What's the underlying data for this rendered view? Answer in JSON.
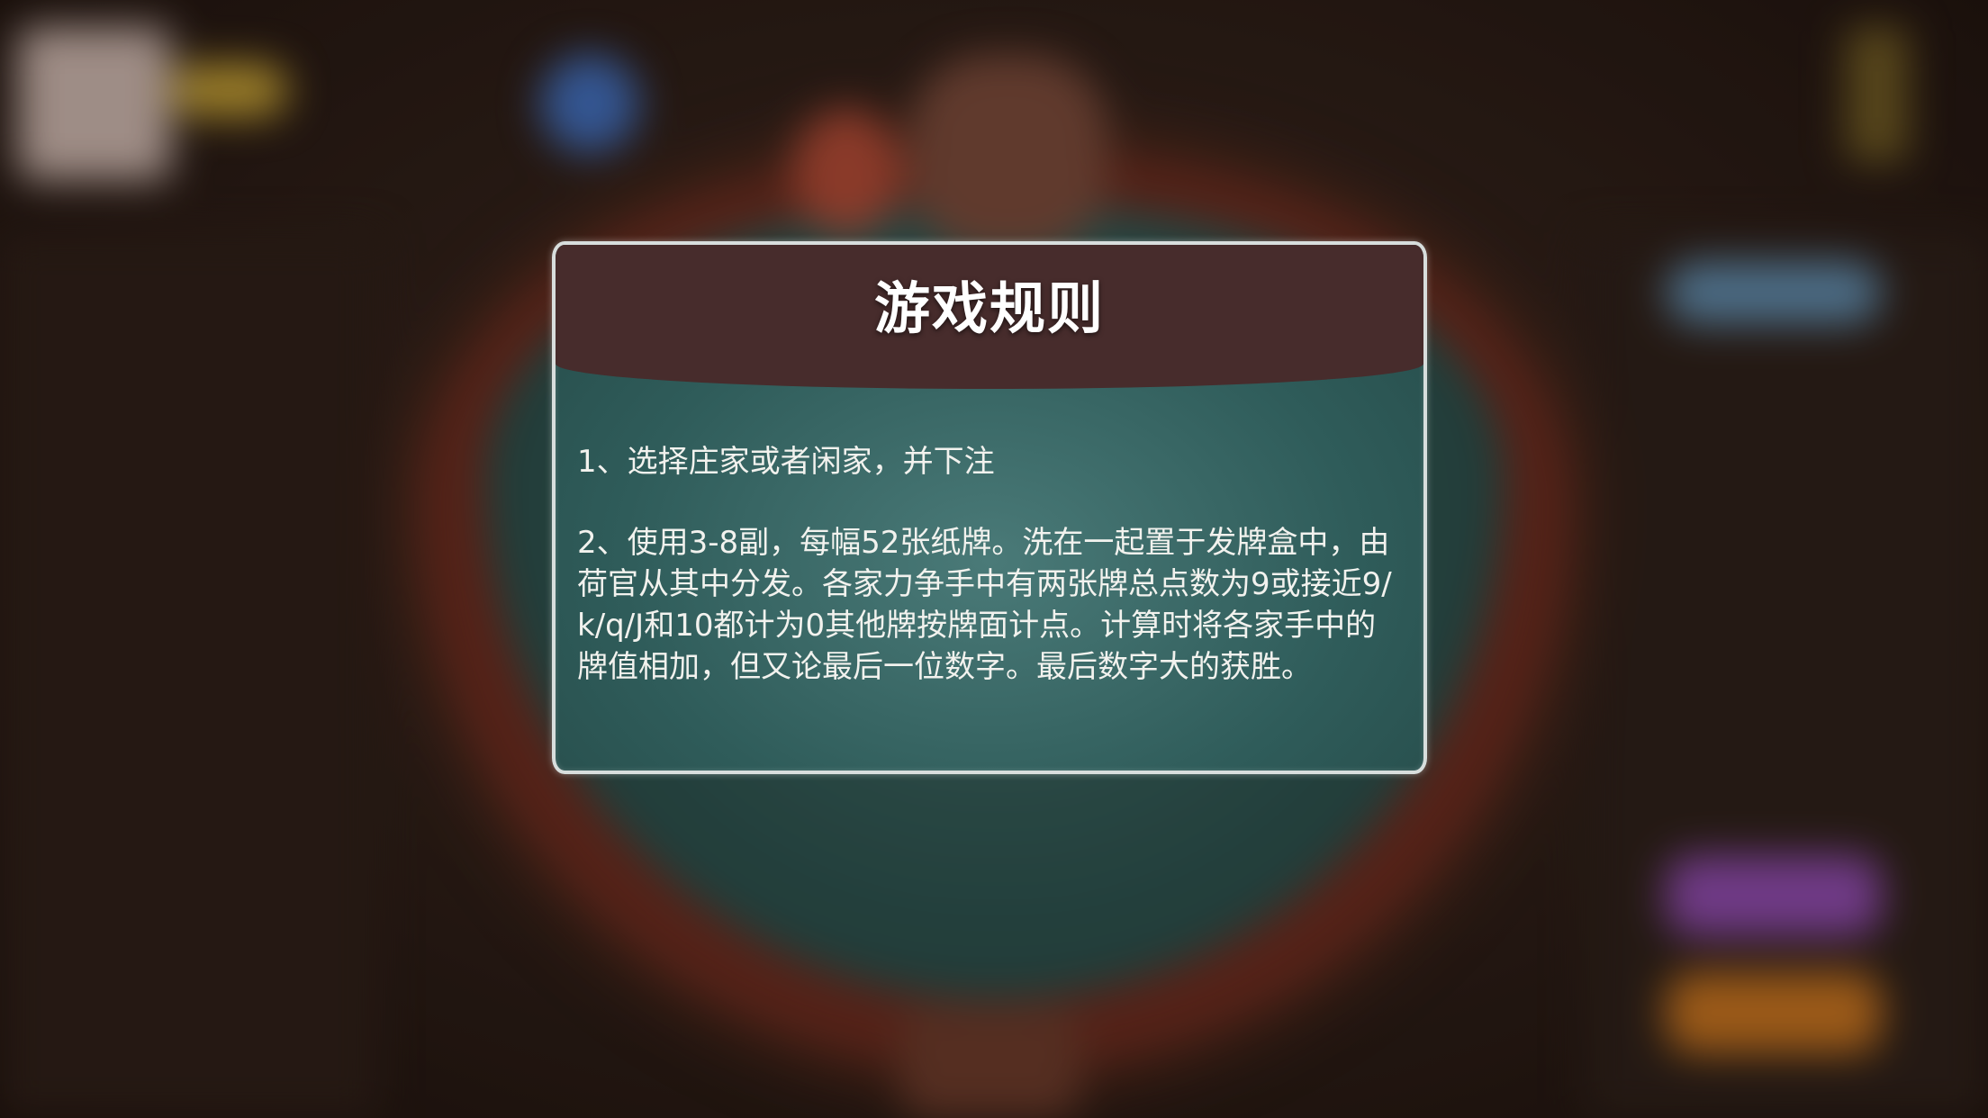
{
  "dialog": {
    "title": "游戏规则",
    "rules": [
      "1、选择庄家或者闲家，并下注",
      "2、使用3-8副，每幅52张纸牌。洗在一起置于发牌盒中，由荷官从其中分发。各家力争手中有两张牌总点数为9或接近9/k/q/J和10都计为0其他牌按牌面计点。计算时将各家手中的牌值相加，但又论最后一位数字。最后数字大的获胜。"
    ]
  },
  "colors": {
    "header": "#472c2c",
    "felt": "#2f5c5a",
    "border": "#d8dedd",
    "text": "#f2f2ee"
  }
}
